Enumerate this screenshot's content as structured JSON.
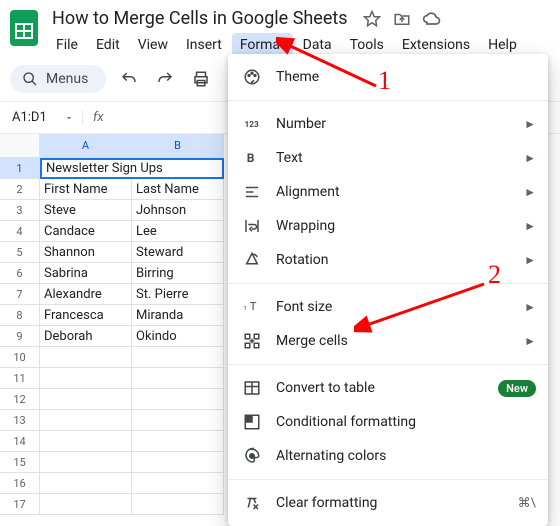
{
  "doc": {
    "title": "How to Merge Cells in Google Sheets"
  },
  "menubar": [
    "File",
    "Edit",
    "View",
    "Insert",
    "Format",
    "Data",
    "Tools",
    "Extensions",
    "Help"
  ],
  "active_menu_index": 4,
  "toolbar": {
    "search_label": "Menus"
  },
  "namebox": {
    "value": "A1:D1"
  },
  "columns": [
    "A",
    "B"
  ],
  "rows_count": 17,
  "sheet": {
    "merged_header": "Newsletter Sign Ups",
    "data": [
      [
        "First Name",
        "Last Name"
      ],
      [
        "Steve",
        "Johnson"
      ],
      [
        "Candace",
        "Lee"
      ],
      [
        "Shannon",
        "Steward"
      ],
      [
        "Sabrina",
        "Birring"
      ],
      [
        "Alexandre",
        "St. Pierre"
      ],
      [
        "Francesca",
        "Miranda"
      ],
      [
        "Deborah",
        "Okindo"
      ]
    ]
  },
  "dropdown": {
    "theme": "Theme",
    "number": "Number",
    "text": "Text",
    "alignment": "Alignment",
    "wrapping": "Wrapping",
    "rotation": "Rotation",
    "fontsize": "Font size",
    "merge": "Merge cells",
    "convert": "Convert to table",
    "convert_badge": "New",
    "conditional": "Conditional formatting",
    "alternating": "Alternating colors",
    "clear": "Clear formatting",
    "clear_shortcut": "⌘\\",
    "submenu_glyph": "►"
  },
  "annotations": {
    "a1": "1",
    "a2": "2"
  }
}
